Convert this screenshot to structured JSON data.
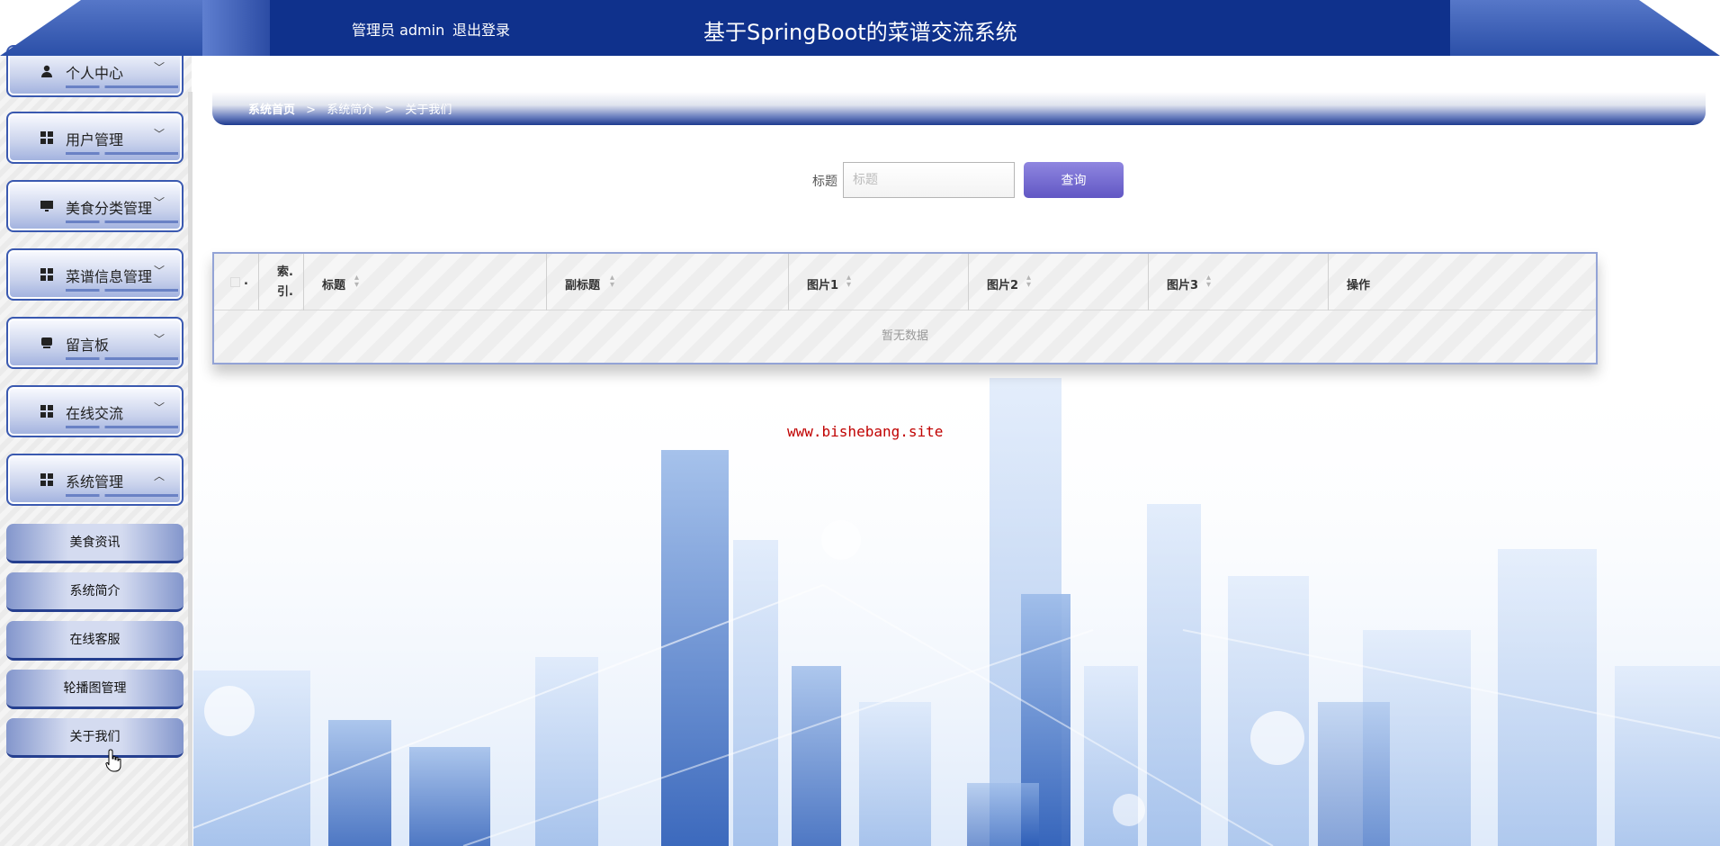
{
  "header": {
    "user_text": "管理员 admin",
    "logout_label": "退出登录",
    "system_title": "基于SpringBoot的菜谱交流系统"
  },
  "sidebar": {
    "menus": [
      {
        "label": "个人中心",
        "icon": "user-icon",
        "expanded": false
      },
      {
        "label": "用户管理",
        "icon": "grid-icon",
        "expanded": false
      },
      {
        "label": "美食分类管理",
        "icon": "monitor-icon",
        "expanded": false
      },
      {
        "label": "菜谱信息管理",
        "icon": "grid-icon",
        "expanded": false
      },
      {
        "label": "留言板",
        "icon": "chat-icon",
        "expanded": false
      },
      {
        "label": "在线交流",
        "icon": "grid-icon",
        "expanded": false
      },
      {
        "label": "系统管理",
        "icon": "grid-icon",
        "expanded": true
      }
    ],
    "submenu": [
      "美食资讯",
      "系统简介",
      "在线客服",
      "轮播图管理",
      "关于我们"
    ]
  },
  "breadcrumb": {
    "home": "系统首页",
    "separator": ">",
    "level1": "系统简介",
    "level2": "关于我们"
  },
  "search": {
    "label": "标题",
    "placeholder": "标题",
    "value": "",
    "button_label": "查询"
  },
  "table": {
    "index_header": "索.\n引.",
    "check_header_suffix": ".",
    "columns": [
      "标题",
      "副标题",
      "图片1",
      "图片2",
      "图片3",
      "操作"
    ],
    "empty_text": "暂无数据"
  },
  "watermark": "www.bishebang.site",
  "colors": {
    "header_bg": "#0f318c",
    "accent_purple": "#6157c4",
    "menu_border": "#3a59b0",
    "watermark": "#c00000"
  }
}
